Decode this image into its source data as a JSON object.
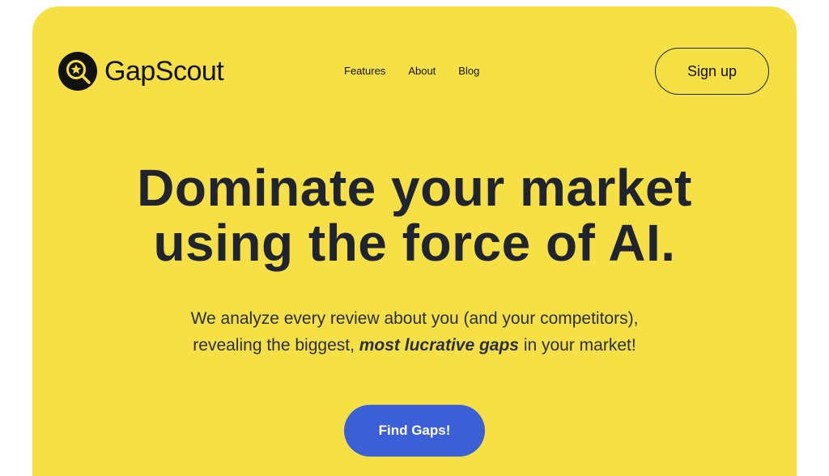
{
  "brand": {
    "name": "GapScout",
    "icon": "magnifier-star-logo-icon"
  },
  "nav": {
    "items": [
      "Features",
      "About",
      "Blog"
    ]
  },
  "header": {
    "signup_label": "Sign up"
  },
  "hero": {
    "headline_line1": "Dominate your market",
    "headline_line2": "using the force of AI.",
    "sub_line1": "We analyze every review about you (and your competitors),",
    "sub_line2_pre": "revealing the biggest, ",
    "sub_line2_em": "most lucrative gaps",
    "sub_line2_post": " in your market!",
    "cta_label": "Find Gaps!"
  },
  "colors": {
    "hero_bg": "#f7e046",
    "text": "#1f2430",
    "cta_bg": "#3b5fd6",
    "cta_text": "#ffffff"
  }
}
